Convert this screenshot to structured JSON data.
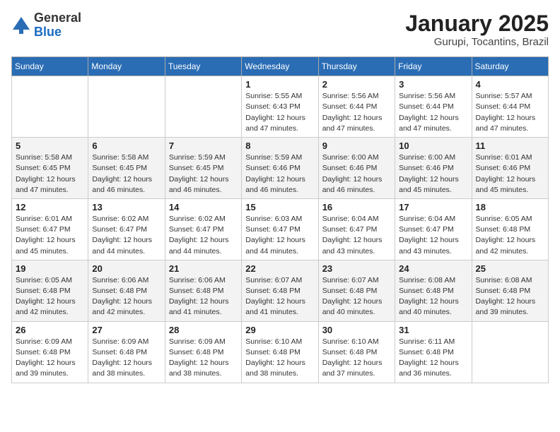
{
  "header": {
    "logo_general": "General",
    "logo_blue": "Blue",
    "month": "January 2025",
    "location": "Gurupi, Tocantins, Brazil"
  },
  "weekdays": [
    "Sunday",
    "Monday",
    "Tuesday",
    "Wednesday",
    "Thursday",
    "Friday",
    "Saturday"
  ],
  "weeks": [
    {
      "alt": false,
      "days": [
        {
          "num": "",
          "text": ""
        },
        {
          "num": "",
          "text": ""
        },
        {
          "num": "",
          "text": ""
        },
        {
          "num": "1",
          "text": "Sunrise: 5:55 AM\nSunset: 6:43 PM\nDaylight: 12 hours\nand 47 minutes."
        },
        {
          "num": "2",
          "text": "Sunrise: 5:56 AM\nSunset: 6:44 PM\nDaylight: 12 hours\nand 47 minutes."
        },
        {
          "num": "3",
          "text": "Sunrise: 5:56 AM\nSunset: 6:44 PM\nDaylight: 12 hours\nand 47 minutes."
        },
        {
          "num": "4",
          "text": "Sunrise: 5:57 AM\nSunset: 6:44 PM\nDaylight: 12 hours\nand 47 minutes."
        }
      ]
    },
    {
      "alt": true,
      "days": [
        {
          "num": "5",
          "text": "Sunrise: 5:58 AM\nSunset: 6:45 PM\nDaylight: 12 hours\nand 47 minutes."
        },
        {
          "num": "6",
          "text": "Sunrise: 5:58 AM\nSunset: 6:45 PM\nDaylight: 12 hours\nand 46 minutes."
        },
        {
          "num": "7",
          "text": "Sunrise: 5:59 AM\nSunset: 6:45 PM\nDaylight: 12 hours\nand 46 minutes."
        },
        {
          "num": "8",
          "text": "Sunrise: 5:59 AM\nSunset: 6:46 PM\nDaylight: 12 hours\nand 46 minutes."
        },
        {
          "num": "9",
          "text": "Sunrise: 6:00 AM\nSunset: 6:46 PM\nDaylight: 12 hours\nand 46 minutes."
        },
        {
          "num": "10",
          "text": "Sunrise: 6:00 AM\nSunset: 6:46 PM\nDaylight: 12 hours\nand 45 minutes."
        },
        {
          "num": "11",
          "text": "Sunrise: 6:01 AM\nSunset: 6:46 PM\nDaylight: 12 hours\nand 45 minutes."
        }
      ]
    },
    {
      "alt": false,
      "days": [
        {
          "num": "12",
          "text": "Sunrise: 6:01 AM\nSunset: 6:47 PM\nDaylight: 12 hours\nand 45 minutes."
        },
        {
          "num": "13",
          "text": "Sunrise: 6:02 AM\nSunset: 6:47 PM\nDaylight: 12 hours\nand 44 minutes."
        },
        {
          "num": "14",
          "text": "Sunrise: 6:02 AM\nSunset: 6:47 PM\nDaylight: 12 hours\nand 44 minutes."
        },
        {
          "num": "15",
          "text": "Sunrise: 6:03 AM\nSunset: 6:47 PM\nDaylight: 12 hours\nand 44 minutes."
        },
        {
          "num": "16",
          "text": "Sunrise: 6:04 AM\nSunset: 6:47 PM\nDaylight: 12 hours\nand 43 minutes."
        },
        {
          "num": "17",
          "text": "Sunrise: 6:04 AM\nSunset: 6:47 PM\nDaylight: 12 hours\nand 43 minutes."
        },
        {
          "num": "18",
          "text": "Sunrise: 6:05 AM\nSunset: 6:48 PM\nDaylight: 12 hours\nand 42 minutes."
        }
      ]
    },
    {
      "alt": true,
      "days": [
        {
          "num": "19",
          "text": "Sunrise: 6:05 AM\nSunset: 6:48 PM\nDaylight: 12 hours\nand 42 minutes."
        },
        {
          "num": "20",
          "text": "Sunrise: 6:06 AM\nSunset: 6:48 PM\nDaylight: 12 hours\nand 42 minutes."
        },
        {
          "num": "21",
          "text": "Sunrise: 6:06 AM\nSunset: 6:48 PM\nDaylight: 12 hours\nand 41 minutes."
        },
        {
          "num": "22",
          "text": "Sunrise: 6:07 AM\nSunset: 6:48 PM\nDaylight: 12 hours\nand 41 minutes."
        },
        {
          "num": "23",
          "text": "Sunrise: 6:07 AM\nSunset: 6:48 PM\nDaylight: 12 hours\nand 40 minutes."
        },
        {
          "num": "24",
          "text": "Sunrise: 6:08 AM\nSunset: 6:48 PM\nDaylight: 12 hours\nand 40 minutes."
        },
        {
          "num": "25",
          "text": "Sunrise: 6:08 AM\nSunset: 6:48 PM\nDaylight: 12 hours\nand 39 minutes."
        }
      ]
    },
    {
      "alt": false,
      "days": [
        {
          "num": "26",
          "text": "Sunrise: 6:09 AM\nSunset: 6:48 PM\nDaylight: 12 hours\nand 39 minutes."
        },
        {
          "num": "27",
          "text": "Sunrise: 6:09 AM\nSunset: 6:48 PM\nDaylight: 12 hours\nand 38 minutes."
        },
        {
          "num": "28",
          "text": "Sunrise: 6:09 AM\nSunset: 6:48 PM\nDaylight: 12 hours\nand 38 minutes."
        },
        {
          "num": "29",
          "text": "Sunrise: 6:10 AM\nSunset: 6:48 PM\nDaylight: 12 hours\nand 38 minutes."
        },
        {
          "num": "30",
          "text": "Sunrise: 6:10 AM\nSunset: 6:48 PM\nDaylight: 12 hours\nand 37 minutes."
        },
        {
          "num": "31",
          "text": "Sunrise: 6:11 AM\nSunset: 6:48 PM\nDaylight: 12 hours\nand 36 minutes."
        },
        {
          "num": "",
          "text": ""
        }
      ]
    }
  ]
}
